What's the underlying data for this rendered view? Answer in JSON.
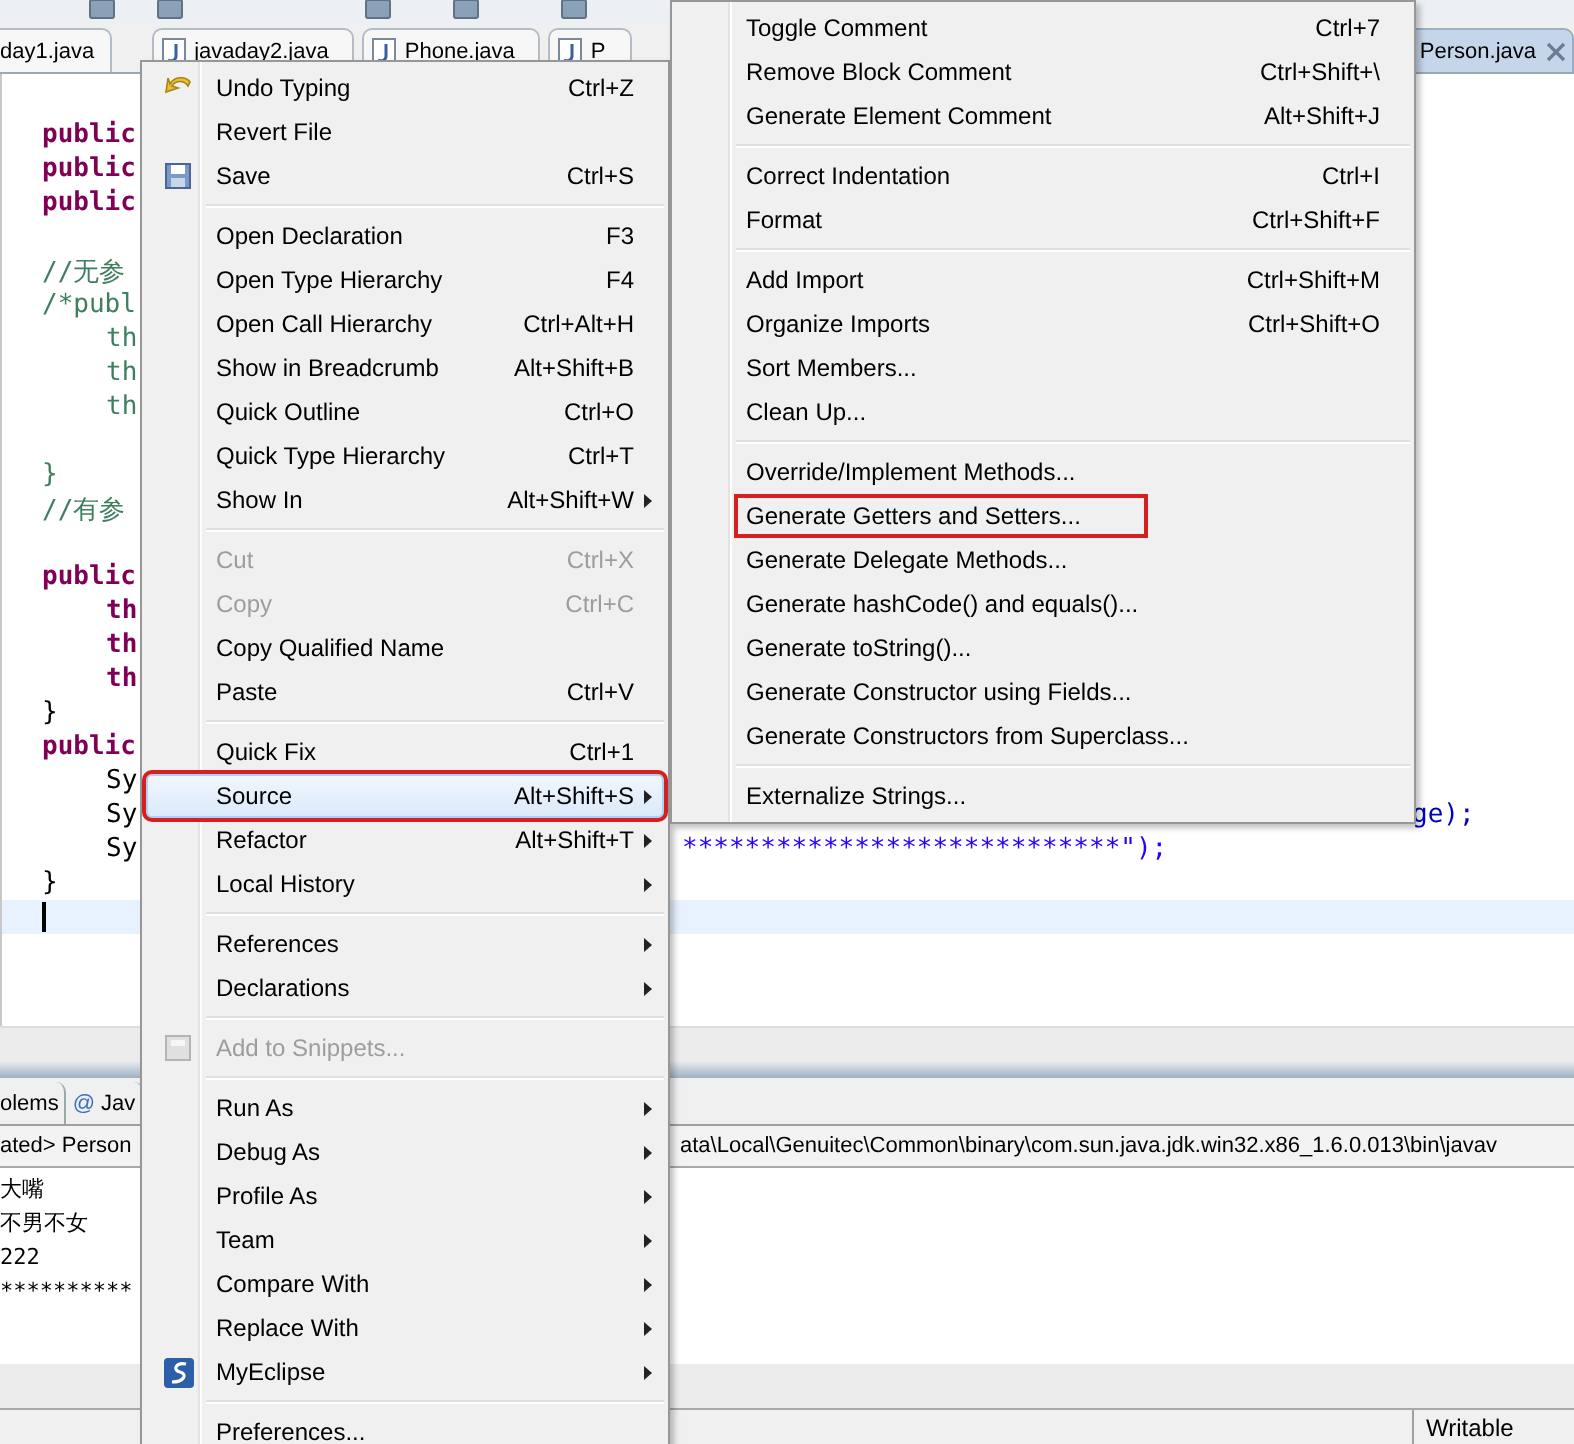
{
  "editor_tabs": [
    {
      "label": "day1.java",
      "selected": false,
      "file_icon": false
    },
    {
      "label": "javaday2.java",
      "selected": false,
      "file_icon": true
    },
    {
      "label": "Phone.java",
      "selected": false,
      "file_icon": true
    },
    {
      "label": "P",
      "selected": false,
      "file_icon": true
    },
    {
      "label": "Person.java",
      "selected": true,
      "file_icon": false
    }
  ],
  "code_lines": [
    {
      "kind": "keyword",
      "text": "public",
      "indented": false
    },
    {
      "kind": "keyword",
      "text": "public",
      "indented": false
    },
    {
      "kind": "keyword",
      "text": "public",
      "indented": false
    },
    {
      "kind": "blank"
    },
    {
      "kind": "comment",
      "text": "//无参",
      "indented": false
    },
    {
      "kind": "comment",
      "text": "/*publ",
      "indented": false
    },
    {
      "kind": "comment",
      "text": "th",
      "indented": true
    },
    {
      "kind": "comment",
      "text": "th",
      "indented": true
    },
    {
      "kind": "comment",
      "text": "th",
      "indented": true
    },
    {
      "kind": "blank"
    },
    {
      "kind": "comment",
      "text": "}",
      "indented": false
    },
    {
      "kind": "comment",
      "text": "//有参",
      "indented": false
    },
    {
      "kind": "blank"
    },
    {
      "kind": "keyword",
      "text": "public",
      "indented": false
    },
    {
      "kind": "keyword",
      "text": "th",
      "indented": true
    },
    {
      "kind": "keyword",
      "text": "th",
      "indented": true
    },
    {
      "kind": "keyword",
      "text": "th",
      "indented": true
    },
    {
      "kind": "plain",
      "text": "}",
      "indented": false
    },
    {
      "kind": "keyword",
      "text": "public",
      "indented": false
    },
    {
      "kind": "plain",
      "text": "Sy",
      "indented": true
    },
    {
      "kind": "plain",
      "text": "Sy",
      "indented": true,
      "far": "ge);"
    },
    {
      "kind": "plain",
      "text": "Sy",
      "indented": true,
      "middle": "****************************\");"
    },
    {
      "kind": "plain",
      "text": "}",
      "indented": false
    },
    {
      "kind": "caret"
    }
  ],
  "context_menu": {
    "groups": [
      [
        {
          "label": "Undo Typing",
          "shortcut": "Ctrl+Z",
          "submenu": false,
          "disabled": false,
          "selected": false,
          "marked": false
        },
        {
          "label": "Revert File",
          "submenu": false,
          "disabled": false,
          "selected": false,
          "marked": false
        },
        {
          "label": "Save",
          "shortcut": "Ctrl+S",
          "submenu": false,
          "disabled": false,
          "selected": false,
          "marked": false
        }
      ],
      [
        {
          "label": "Open Declaration",
          "shortcut": "F3",
          "submenu": false,
          "disabled": false,
          "selected": false,
          "marked": false
        },
        {
          "label": "Open Type Hierarchy",
          "shortcut": "F4",
          "submenu": false,
          "disabled": false,
          "selected": false,
          "marked": false
        },
        {
          "label": "Open Call Hierarchy",
          "shortcut": "Ctrl+Alt+H",
          "submenu": false,
          "disabled": false,
          "selected": false,
          "marked": false
        },
        {
          "label": "Show in Breadcrumb",
          "shortcut": "Alt+Shift+B",
          "submenu": false,
          "disabled": false,
          "selected": false,
          "marked": false
        },
        {
          "label": "Quick Outline",
          "shortcut": "Ctrl+O",
          "submenu": false,
          "disabled": false,
          "selected": false,
          "marked": false
        },
        {
          "label": "Quick Type Hierarchy",
          "shortcut": "Ctrl+T",
          "submenu": false,
          "disabled": false,
          "selected": false,
          "marked": false
        },
        {
          "label": "Show In",
          "shortcut": "Alt+Shift+W",
          "submenu": true,
          "disabled": false,
          "selected": false,
          "marked": false
        }
      ],
      [
        {
          "label": "Cut",
          "shortcut": "Ctrl+X",
          "submenu": false,
          "disabled": true,
          "selected": false,
          "marked": false
        },
        {
          "label": "Copy",
          "shortcut": "Ctrl+C",
          "submenu": false,
          "disabled": true,
          "selected": false,
          "marked": false
        },
        {
          "label": "Copy Qualified Name",
          "submenu": false,
          "disabled": false,
          "selected": false,
          "marked": false
        },
        {
          "label": "Paste",
          "shortcut": "Ctrl+V",
          "submenu": false,
          "disabled": false,
          "selected": false,
          "marked": false
        }
      ],
      [
        {
          "label": "Quick Fix",
          "shortcut": "Ctrl+1",
          "submenu": false,
          "disabled": false,
          "selected": false,
          "marked": false
        },
        {
          "label": "Source",
          "shortcut": "Alt+Shift+S",
          "submenu": true,
          "disabled": false,
          "selected": true,
          "marked": true
        },
        {
          "label": "Refactor",
          "shortcut": "Alt+Shift+T",
          "submenu": true,
          "disabled": false,
          "selected": false,
          "marked": false
        },
        {
          "label": "Local History",
          "submenu": true,
          "disabled": false,
          "selected": false,
          "marked": false
        }
      ],
      [
        {
          "label": "References",
          "submenu": true,
          "disabled": false,
          "selected": false,
          "marked": false
        },
        {
          "label": "Declarations",
          "submenu": true,
          "disabled": false,
          "selected": false,
          "marked": false
        }
      ],
      [
        {
          "label": "Add to Snippets...",
          "submenu": false,
          "disabled": true,
          "selected": false,
          "marked": false
        }
      ],
      [
        {
          "label": "Run As",
          "submenu": true,
          "disabled": false,
          "selected": false,
          "marked": false
        },
        {
          "label": "Debug As",
          "submenu": true,
          "disabled": false,
          "selected": false,
          "marked": false
        },
        {
          "label": "Profile As",
          "submenu": true,
          "disabled": false,
          "selected": false,
          "marked": false
        },
        {
          "label": "Team",
          "submenu": true,
          "disabled": false,
          "selected": false,
          "marked": false
        },
        {
          "label": "Compare With",
          "submenu": true,
          "disabled": false,
          "selected": false,
          "marked": false
        },
        {
          "label": "Replace With",
          "submenu": true,
          "disabled": false,
          "selected": false,
          "marked": false
        },
        {
          "label": "MyEclipse",
          "submenu": true,
          "disabled": false,
          "selected": false,
          "marked": false
        }
      ],
      [
        {
          "label": "Preferences...",
          "submenu": false,
          "disabled": false,
          "selected": false,
          "marked": false
        }
      ]
    ]
  },
  "source_submenu": {
    "groups": [
      [
        {
          "label": "Toggle Comment",
          "shortcut": "Ctrl+7",
          "submenu": false,
          "disabled": false,
          "selected": false,
          "marked": false
        },
        {
          "label": "Remove Block Comment",
          "shortcut": "Ctrl+Shift+\\",
          "submenu": false,
          "disabled": false,
          "selected": false,
          "marked": false
        },
        {
          "label": "Generate Element Comment",
          "shortcut": "Alt+Shift+J",
          "submenu": false,
          "disabled": false,
          "selected": false,
          "marked": false
        }
      ],
      [
        {
          "label": "Correct Indentation",
          "shortcut": "Ctrl+I",
          "submenu": false,
          "disabled": false,
          "selected": false,
          "marked": false
        },
        {
          "label": "Format",
          "shortcut": "Ctrl+Shift+F",
          "submenu": false,
          "disabled": false,
          "selected": false,
          "marked": false
        }
      ],
      [
        {
          "label": "Add Import",
          "shortcut": "Ctrl+Shift+M",
          "submenu": false,
          "disabled": false,
          "selected": false,
          "marked": false
        },
        {
          "label": "Organize Imports",
          "shortcut": "Ctrl+Shift+O",
          "submenu": false,
          "disabled": false,
          "selected": false,
          "marked": false
        },
        {
          "label": "Sort Members...",
          "submenu": false,
          "disabled": false,
          "selected": false,
          "marked": false
        },
        {
          "label": "Clean Up...",
          "submenu": false,
          "disabled": false,
          "selected": false,
          "marked": false
        }
      ],
      [
        {
          "label": "Override/Implement Methods...",
          "submenu": false,
          "disabled": false,
          "selected": false,
          "marked": false
        },
        {
          "label": "Generate Getters and Setters...",
          "submenu": false,
          "disabled": false,
          "selected": false,
          "marked": true
        },
        {
          "label": "Generate Delegate Methods...",
          "submenu": false,
          "disabled": false,
          "selected": false,
          "marked": false
        },
        {
          "label": "Generate hashCode() and equals()...",
          "submenu": false,
          "disabled": false,
          "selected": false,
          "marked": false
        },
        {
          "label": "Generate toString()...",
          "submenu": false,
          "disabled": false,
          "selected": false,
          "marked": false
        },
        {
          "label": "Generate Constructor using Fields...",
          "submenu": false,
          "disabled": false,
          "selected": false,
          "marked": false
        },
        {
          "label": "Generate Constructors from Superclass...",
          "submenu": false,
          "disabled": false,
          "selected": false,
          "marked": false
        }
      ],
      [
        {
          "label": "Externalize Strings...",
          "submenu": false,
          "disabled": false,
          "selected": false,
          "marked": false
        }
      ]
    ]
  },
  "console": {
    "tabs": [
      {
        "label": "olems",
        "selected": false
      },
      {
        "glyph": "@",
        "label": "Jav",
        "selected": false
      }
    ],
    "header_left": "ated> Person",
    "header_right": "ata\\Local\\Genuitec\\Common\\binary\\com.sun.java.jdk.win32.x86_1.6.0.013\\bin\\javav",
    "lines": [
      "大嘴",
      "不男不女",
      "222",
      "**********"
    ]
  },
  "status_bar": {
    "state": "Writable"
  }
}
